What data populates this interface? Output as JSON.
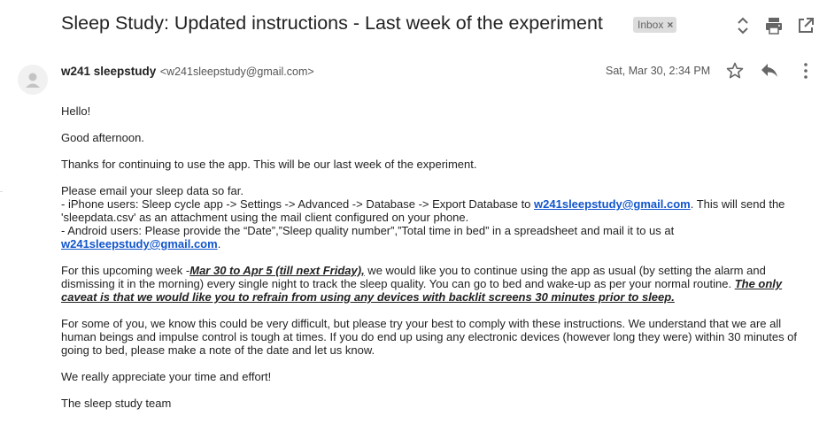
{
  "email": {
    "subject": "Sleep Study: Updated instructions - Last week of the experiment",
    "label": "Inbox",
    "label_close": "×",
    "sender_name": "w241 sleepstudy",
    "sender_email": "<w241sleepstudy@gmail.com>",
    "date": "Sat, Mar 30, 2:34 PM"
  },
  "icons": {
    "expand": "unfold-icon",
    "print": "print-icon",
    "new_window": "open-in-new-icon",
    "star": "star-icon",
    "reply": "reply-icon",
    "more": "more-vert-icon",
    "avatar": "person-icon"
  },
  "body": {
    "greeting": "Hello!",
    "good_afternoon": "Good afternoon.",
    "thanks": "Thanks for continuing to use the app. This will be our last week of the experiment.",
    "please_email": "Please email your sleep data so far.",
    "iphone_pre": "- iPhone users: Sleep cycle app -> Settings -> Advanced -> Database  -> Export Database to ",
    "iphone_link": "w241sleepstudy@gmail.com",
    "iphone_post": ". This will send the 'sleepdata.csv' as an attachment using the mail client configured on your phone.",
    "android_pre": "- Android users: Please provide the “Date”,”Sleep quality number”,”Total time in bed” in a spreadsheet and mail it to us at ",
    "android_link": "w241sleepstudy@gmail.com",
    "android_post": ".",
    "week_pre": " For this upcoming week -",
    "week_dates": "Mar 30 to Apr 5 (till next Friday),",
    "week_mid": " we would like you to continue using the app as usual (by setting the alarm and dismissing it in the morning) every single night to track the sleep quality.  You can go to bed and wake-up as per your normal routine. ",
    "week_caveat": "The only caveat is that we would like you to refrain from using any devices with backlit screens 30 minutes prior to sleep.",
    "difficult": " For some of you, we know this could be very difficult, but please try your best to comply with these instructions.  We understand that we are all human beings and impulse control is tough at times.  If you do end up using any electronic devices (however long they were) within 30 minutes of going to bed, please make a note of the date and let us know.",
    "appreciate": "We really appreciate your time and effort!",
    "signature": "The sleep study team"
  },
  "colors": {
    "link": "#1155cc",
    "badge_bg": "#dddddd",
    "icon": "#666666"
  }
}
